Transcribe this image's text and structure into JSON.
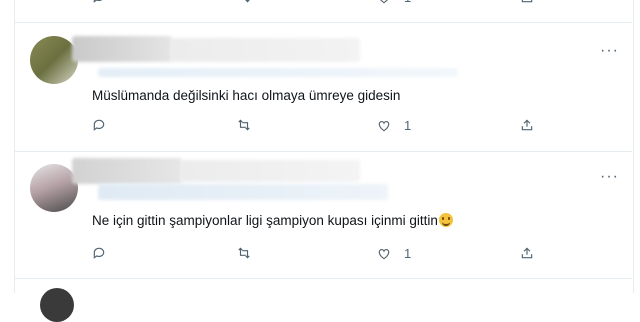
{
  "top_partial": {
    "like_count": "1"
  },
  "replies": [
    {
      "text": "Müslümanda değilsinki hacı olmaya ümreye gidesin",
      "reply_count": "",
      "retweet_count": "",
      "like_count": "1"
    },
    {
      "text": "Ne için gittin şampiyonlar ligi şampiyon kupası içinmi gittin",
      "emoji": "grinning-face",
      "reply_count": "",
      "retweet_count": "",
      "like_count": "1"
    }
  ],
  "more_label": "···",
  "colors": {
    "icon": "#536471",
    "text": "#0f1419",
    "divider": "#e6ecf0",
    "emoji": "#f5c33b"
  }
}
